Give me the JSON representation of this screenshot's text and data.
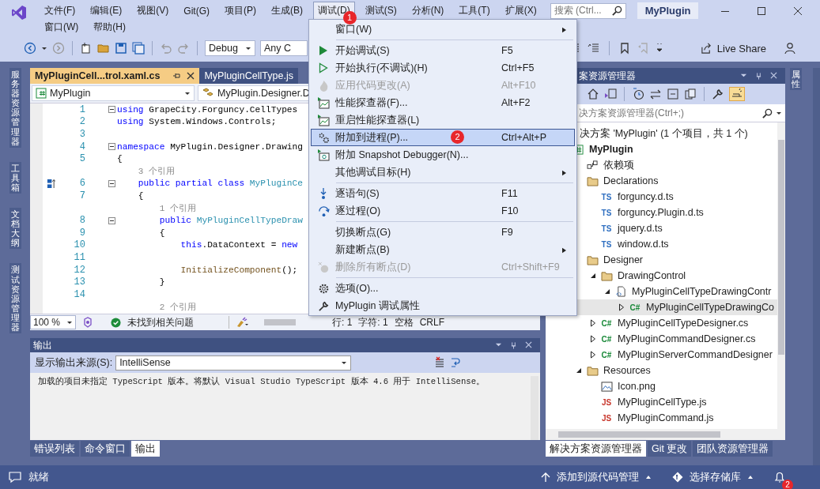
{
  "titlebar": {
    "menus": [
      {
        "label": "文件(F)",
        "selected": false
      },
      {
        "label": "编辑(E)",
        "selected": false
      },
      {
        "label": "视图(V)",
        "selected": false
      },
      {
        "label": "Git(G)",
        "selected": false
      },
      {
        "label": "项目(P)",
        "selected": false
      },
      {
        "label": "生成(B)",
        "selected": false
      },
      {
        "label": "调试(D)",
        "selected": true,
        "badge": "1"
      },
      {
        "label": "测试(S)",
        "selected": false
      },
      {
        "label": "分析(N)",
        "selected": false
      },
      {
        "label": "工具(T)",
        "selected": false
      },
      {
        "label": "扩展(X)",
        "selected": false
      }
    ],
    "menus_row2": [
      {
        "label": "窗口(W)",
        "selected": false
      },
      {
        "label": "帮助(H)",
        "selected": false
      }
    ],
    "search": {
      "placeholder": "搜索 (Ctrl..."
    },
    "title": "MyPlugin"
  },
  "toolbar": {
    "configuration": "Debug",
    "platform": "Any C",
    "live_share": "Live Share"
  },
  "left_tabs": [
    "服务器资源管理器",
    "工具箱",
    "文档大纲",
    "测试资源管理器"
  ],
  "right_tabs": [
    "属性"
  ],
  "editor": {
    "tabs": [
      {
        "label": "MyPluginCell...trol.xaml.cs",
        "selected": true
      },
      {
        "label": "MyPluginCellType.js",
        "selected": false
      }
    ],
    "nav": [
      "MyPlugin",
      "MyPlugin.Designer.D"
    ],
    "lines": [
      {
        "kind": "code",
        "num": "1",
        "fold": true,
        "marker": false,
        "tokens": [
          {
            "kind": "keyword",
            "text": "using"
          },
          {
            "kind": "plain",
            "text": " GrapeCity.Forguncy.CellTypes"
          }
        ]
      },
      {
        "kind": "code",
        "num": "2",
        "fold": false,
        "marker": false,
        "tokens": [
          {
            "kind": "keyword",
            "text": "using"
          },
          {
            "kind": "plain",
            "text": " System.Windows.Controls;"
          }
        ]
      },
      {
        "kind": "code",
        "num": "3",
        "fold": false,
        "marker": false
      },
      {
        "kind": "code",
        "num": "4",
        "fold": true,
        "marker": false,
        "tokens": [
          {
            "kind": "keyword",
            "text": "namespace"
          },
          {
            "kind": "plain",
            "text": " MyPlugin.Designer.Drawing"
          }
        ]
      },
      {
        "kind": "code",
        "num": "5",
        "fold": false,
        "marker": false,
        "tokens": [
          {
            "kind": "plain",
            "text": "{"
          }
        ],
        "children": [
          {
            "kind": "lens",
            "text": "3 个引用"
          },
          {
            "kind": "code",
            "num": "6",
            "fold": true,
            "marker": true,
            "tokens": [
              {
                "kind": "keyword",
                "text": "public partial class"
              },
              {
                "kind": "type",
                "text": " MyPluginCe"
              }
            ]
          },
          {
            "kind": "code",
            "num": "7",
            "fold": false,
            "marker": false,
            "tokens": [
              {
                "kind": "plain",
                "text": "{"
              }
            ],
            "children": [
              {
                "kind": "lens",
                "text": "1 个引用"
              },
              {
                "kind": "code",
                "num": "8",
                "fold": true,
                "marker": false,
                "tokens": [
                  {
                    "kind": "keyword",
                    "text": "public"
                  },
                  {
                    "kind": "type",
                    "text": " MyPluginCellTypeDraw"
                  }
                ]
              },
              {
                "kind": "code",
                "num": "9",
                "fold": false,
                "marker": false,
                "tokens": [
                  {
                    "kind": "plain",
                    "text": "{"
                  }
                ],
                "children": [
                  {
                    "kind": "code",
                    "num": "10",
                    "fold": false,
                    "marker": false,
                    "tokens": [
                      {
                        "kind": "keyword",
                        "text": "this"
                      },
                      {
                        "kind": "plain",
                        "text": ".DataContext = "
                      },
                      {
                        "kind": "keyword",
                        "text": "new"
                      }
                    ]
                  },
                  {
                    "kind": "code",
                    "num": "11",
                    "fold": false,
                    "marker": false
                  },
                  {
                    "kind": "code",
                    "num": "12",
                    "fold": false,
                    "marker": false,
                    "tokens": [
                      {
                        "kind": "method",
                        "text": "InitializeComponent"
                      },
                      {
                        "kind": "plain",
                        "text": "();"
                      }
                    ]
                  }
                ]
              },
              {
                "kind": "code",
                "num": "13",
                "fold": false,
                "marker": false,
                "tokens": [
                  {
                    "kind": "plain",
                    "text": "}"
                  }
                ]
              },
              {
                "kind": "code",
                "num": "14",
                "fold": false,
                "marker": false
              },
              {
                "kind": "lens",
                "text": "2 个引用"
              }
            ]
          }
        ]
      }
    ],
    "status": {
      "zoom": "100 %",
      "issues": "未找到相关问题",
      "line": "行: 1",
      "char": "字符: 1",
      "spacing": "空格",
      "eol": "CRLF"
    }
  },
  "debug_menu": {
    "items": [
      {
        "kind": "plain",
        "label": "窗口(W)",
        "submenu": true,
        "disabled": false,
        "selected": false
      },
      {
        "kind": "separator"
      },
      {
        "kind": "start",
        "label": "开始调试(S)",
        "shortcut": "F5",
        "submenu": false,
        "disabled": false,
        "selected": false
      },
      {
        "kind": "start-without-debugging",
        "label": "开始执行(不调试)(H)",
        "shortcut": "Ctrl+F5",
        "submenu": false,
        "disabled": false,
        "selected": false
      },
      {
        "kind": "hot-reload",
        "label": "应用代码更改(A)",
        "shortcut": "Alt+F10",
        "submenu": false,
        "disabled": true,
        "selected": false
      },
      {
        "kind": "profiler",
        "label": "性能探查器(F)...",
        "shortcut": "Alt+F2",
        "submenu": false,
        "disabled": false,
        "selected": false
      },
      {
        "kind": "profiler",
        "label": "重启性能探查器(L)",
        "submenu": false,
        "disabled": false,
        "selected": false
      },
      {
        "kind": "attach",
        "label": "附加到进程(P)...",
        "shortcut": "Ctrl+Alt+P",
        "submenu": false,
        "disabled": false,
        "selected": true,
        "badge": "2"
      },
      {
        "kind": "snapshot",
        "label": "附加 Snapshot Debugger(N)...",
        "submenu": false,
        "disabled": false,
        "selected": false
      },
      {
        "kind": "plain",
        "label": "其他调试目标(H)",
        "submenu": true,
        "disabled": false,
        "selected": false
      },
      {
        "kind": "separator"
      },
      {
        "kind": "step-into",
        "label": "逐语句(S)",
        "shortcut": "F11",
        "submenu": false,
        "disabled": false,
        "selected": false
      },
      {
        "kind": "step-over",
        "label": "逐过程(O)",
        "shortcut": "F10",
        "submenu": false,
        "disabled": false,
        "selected": false
      },
      {
        "kind": "separator"
      },
      {
        "kind": "plain",
        "label": "切换断点(G)",
        "shortcut": "F9",
        "submenu": false,
        "disabled": false,
        "selected": false
      },
      {
        "kind": "plain",
        "label": "新建断点(B)",
        "submenu": true,
        "disabled": false,
        "selected": false
      },
      {
        "kind": "delete-breakpoints",
        "label": "删除所有断点(D)",
        "shortcut": "Ctrl+Shift+F9",
        "submenu": false,
        "disabled": true,
        "selected": false
      },
      {
        "kind": "separator"
      },
      {
        "kind": "options",
        "label": "选项(O)...",
        "submenu": false,
        "disabled": false,
        "selected": false
      },
      {
        "kind": "properties",
        "label": "MyPlugin 调试属性",
        "submenu": false,
        "disabled": false,
        "selected": false
      }
    ]
  },
  "solution_explorer": {
    "title": "案资源管理器",
    "search": {
      "placeholder": "决方案资源管理器(Ctrl+;)"
    },
    "tree": [
      {
        "kind": "solution",
        "label": "决方案 'MyPlugin' (1 个项目，共 1 个)",
        "selected": false,
        "children": [
          {
            "kind": "project",
            "label": "MyPlugin",
            "selected": false,
            "children": [
              {
                "kind": "deps",
                "label": "依赖项",
                "selected": false
              },
              {
                "kind": "folder",
                "label": "Declarations",
                "selected": false,
                "children": [
                  {
                    "kind": "file",
                    "glyph": "TS",
                    "label": "forguncy.d.ts",
                    "selected": false
                  },
                  {
                    "kind": "file",
                    "glyph": "TS",
                    "label": "forguncy.Plugin.d.ts",
                    "selected": false
                  },
                  {
                    "kind": "file",
                    "glyph": "TS",
                    "label": "jquery.d.ts",
                    "selected": false
                  },
                  {
                    "kind": "file",
                    "glyph": "TS",
                    "label": "window.d.ts",
                    "selected": false
                  }
                ]
              },
              {
                "kind": "folder",
                "label": "Designer",
                "selected": false,
                "children": [
                  {
                    "kind": "folder",
                    "label": "DrawingControl",
                    "expanded": true,
                    "selected": false,
                    "children": [
                      {
                        "kind": "xaml",
                        "label": "MyPluginCellTypeDrawingContr",
                        "expanded": true,
                        "selected": false,
                        "children": [
                          {
                            "kind": "file",
                            "glyph": "C#",
                            "label": "MyPluginCellTypeDrawingCo",
                            "expanded": false,
                            "selected": true
                          }
                        ]
                      }
                    ]
                  },
                  {
                    "kind": "file",
                    "glyph": "C#",
                    "label": "MyPluginCellTypeDesigner.cs",
                    "expanded": false,
                    "selected": false
                  },
                  {
                    "kind": "file",
                    "glyph": "C#",
                    "label": "MyPluginCommandDesigner.cs",
                    "expanded": false,
                    "selected": false
                  },
                  {
                    "kind": "file",
                    "glyph": "C#",
                    "label": "MyPluginServerCommandDesigner",
                    "expanded": false,
                    "selected": false
                  }
                ]
              },
              {
                "kind": "folder",
                "label": "Resources",
                "expanded": true,
                "selected": false,
                "children": [
                  {
                    "kind": "image",
                    "label": "Icon.png",
                    "selected": false
                  },
                  {
                    "kind": "file",
                    "glyph": "JS",
                    "label": "MyPluginCellType.js",
                    "selected": false
                  },
                  {
                    "kind": "file",
                    "glyph": "JS",
                    "label": "MyPluginCommand.js",
                    "selected": false
                  }
                ]
              }
            ]
          }
        ]
      }
    ],
    "tabs": [
      {
        "label": "解决方案资源管理器",
        "selected": true
      },
      {
        "label": "Git 更改",
        "selected": false
      },
      {
        "label": "团队资源管理器",
        "selected": false
      }
    ]
  },
  "output": {
    "title": "输出",
    "source_label": "显示输出来源(S):",
    "source": "IntelliSense",
    "text": "加载的项目未指定 TypeScript 版本。将默认 Visual Studio TypeScript 版本 4.6 用于 IntelliSense。",
    "tabs": [
      {
        "label": "错误列表",
        "selected": false
      },
      {
        "label": "命令窗口",
        "selected": false
      },
      {
        "label": "输出",
        "selected": true
      }
    ]
  },
  "status_bar": {
    "message": "就绪",
    "source_control": "添加到源代码管理",
    "repository": "选择存储库",
    "notifications": "2"
  }
}
